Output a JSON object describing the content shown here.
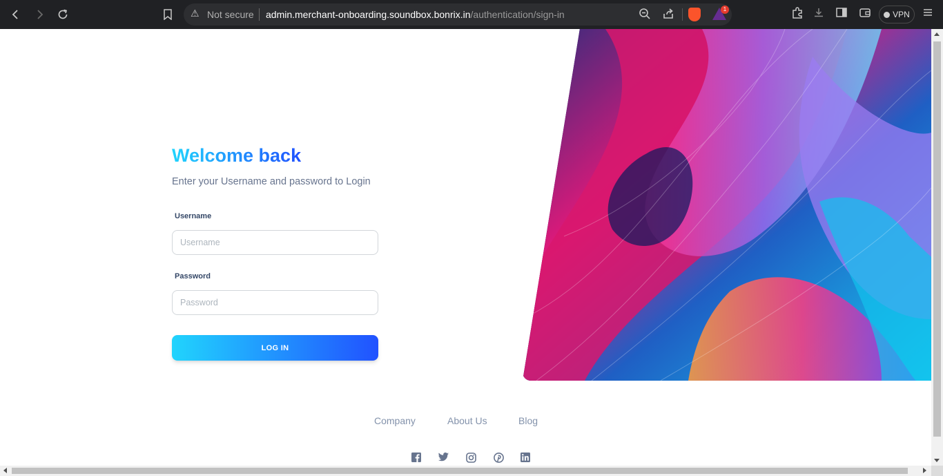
{
  "browser": {
    "security_text": "Not secure",
    "url_host": "admin.merchant-onboarding.soundbox.bonrix.in",
    "url_path": "/authentication/sign-in",
    "rewards_badge": "1",
    "vpn_label": "VPN"
  },
  "login": {
    "title": "Welcome back",
    "subtitle": "Enter your Username and password to Login",
    "username_label": "Username",
    "username_placeholder": "Username",
    "password_label": "Password",
    "password_placeholder": "Password",
    "button_label": "LOG IN"
  },
  "footer": {
    "links": [
      "Company",
      "About Us",
      "Blog"
    ],
    "social_icons": [
      "facebook-icon",
      "twitter-icon",
      "instagram-icon",
      "pinterest-icon",
      "linkedin-icon"
    ]
  },
  "colors": {
    "gradient_start": "#21d4fd",
    "gradient_end": "#2152ff",
    "text_muted": "#67748e",
    "label": "#344767",
    "footer_link": "#8392ab",
    "social_icon": "#67748e"
  }
}
